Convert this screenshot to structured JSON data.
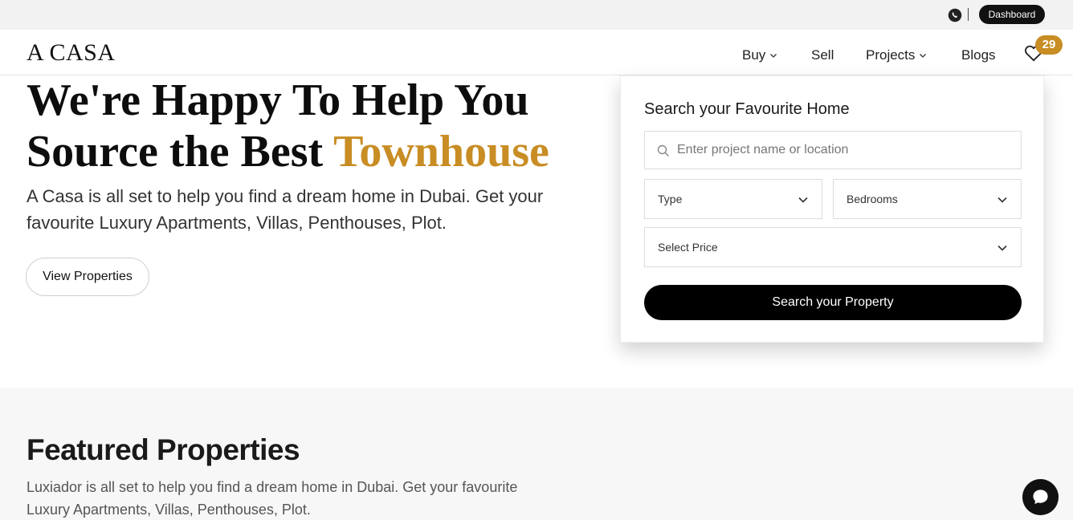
{
  "topbar": {
    "whatsapp_icon": "whatsapp-icon",
    "separator": "|",
    "dashboard_label": "Dashboard"
  },
  "nav": {
    "logo": "A CASA",
    "items": [
      {
        "label": "Buy",
        "dropdown": true
      },
      {
        "label": "Sell",
        "dropdown": false
      },
      {
        "label": "Projects",
        "dropdown": true
      },
      {
        "label": "Blogs",
        "dropdown": false
      }
    ],
    "favorites_icon": "heart-icon",
    "favorites_count": "29"
  },
  "hero": {
    "title_line1": "We're Happy To Help You",
    "title_line2_prefix": "Source the Best ",
    "title_line2_accent": "Townhouse",
    "description": "A Casa is all set to help you find a dream home in Dubai. Get your favourite Luxury Apartments, Villas, Penthouses, Plot.",
    "cta_label": "View Properties"
  },
  "search": {
    "title": "Search your Favourite Home",
    "placeholder": "Enter project name or location",
    "type_label": "Type",
    "bedrooms_label": "Bedrooms",
    "price_label": "Select Price",
    "submit_label": "Search your Property"
  },
  "featured": {
    "title": "Featured Properties",
    "description": "Luxiador is all set to help you find a dream home in Dubai. Get your favourite Luxury Apartments, Villas, Penthouses, Plot."
  },
  "chat": {
    "icon": "chat-icon"
  },
  "colors": {
    "accent": "#c88d24",
    "dark": "#000000",
    "topbar_bg": "#f2f2f2",
    "section_bg": "#f7f7f7"
  }
}
